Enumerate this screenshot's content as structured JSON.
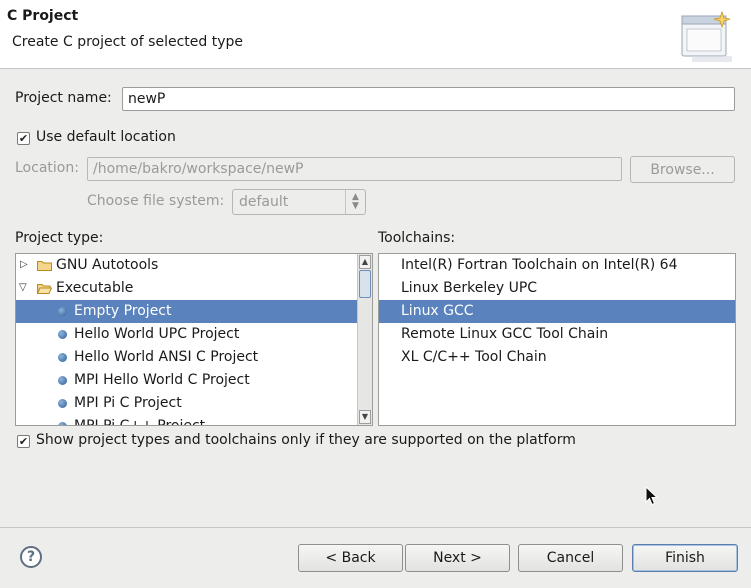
{
  "header": {
    "title": "C Project",
    "description": "Create C project of selected type",
    "banner_icon": "new-project-wizard-icon"
  },
  "project_name": {
    "label": "Project name:",
    "value": "newP"
  },
  "default_location": {
    "label": "Use default location",
    "checked": true
  },
  "location": {
    "label": "Location:",
    "value": "/home/bakro/workspace/newP",
    "browse_label": "Browse..."
  },
  "file_system": {
    "label": "Choose file system:",
    "value": "default"
  },
  "project_type": {
    "label": "Project type:",
    "items": [
      {
        "label": "GNU Autotools",
        "kind": "folder",
        "expanded": false
      },
      {
        "label": "Executable",
        "kind": "folder",
        "expanded": true
      },
      {
        "label": "Empty Project",
        "kind": "leaf",
        "selected": true
      },
      {
        "label": "Hello World UPC Project",
        "kind": "leaf"
      },
      {
        "label": "Hello World ANSI C Project",
        "kind": "leaf"
      },
      {
        "label": "MPI Hello World C Project",
        "kind": "leaf"
      },
      {
        "label": "MPI Pi C Project",
        "kind": "leaf"
      },
      {
        "label": "MPI Pi C++ Project",
        "kind": "leaf"
      }
    ]
  },
  "toolchains": {
    "label": "Toolchains:",
    "items": [
      {
        "label": "Intel(R) Fortran Toolchain on Intel(R) 64"
      },
      {
        "label": "Linux Berkeley UPC"
      },
      {
        "label": "Linux GCC",
        "selected": true
      },
      {
        "label": "Remote Linux GCC Tool Chain"
      },
      {
        "label": "XL C/C++ Tool Chain"
      }
    ]
  },
  "supported_only": {
    "label": "Show project types and toolchains only if they are supported on the platform",
    "checked": true
  },
  "buttons": {
    "back": "< Back",
    "next": "Next >",
    "cancel": "Cancel",
    "finish": "Finish",
    "help": "?"
  },
  "colors": {
    "selection": "#5a82bd",
    "dialog_bg": "#ededec"
  }
}
